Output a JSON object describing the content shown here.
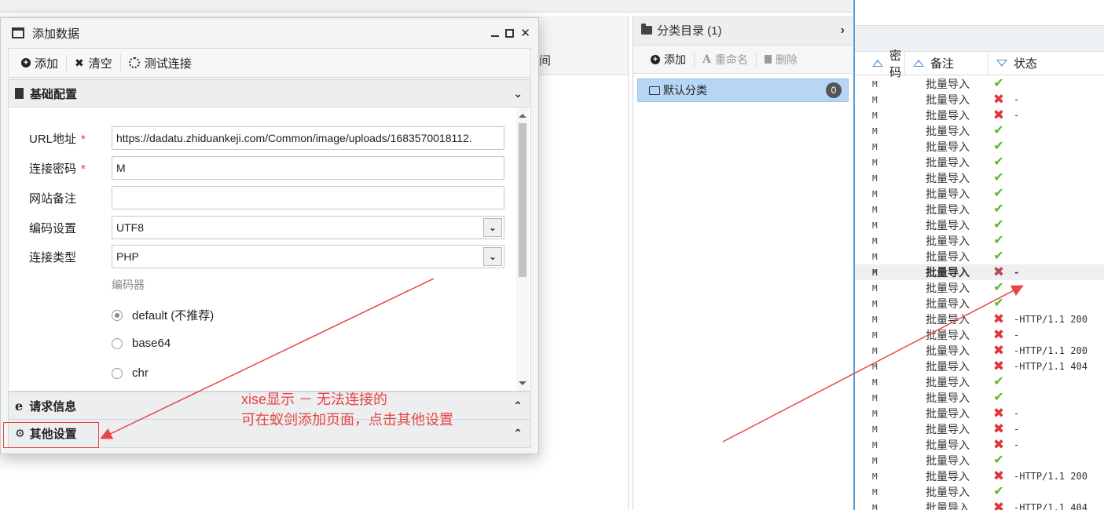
{
  "background": {
    "column_label": "间"
  },
  "category_panel": {
    "title": "分类目录 (1)",
    "toolbar": {
      "add": "添加",
      "rename": "重命名",
      "delete": "删除"
    },
    "items": [
      {
        "label": "默认分类",
        "count": "0"
      }
    ]
  },
  "list_panel": {
    "headers": {
      "password": "密码",
      "note": "备注",
      "status": "状态"
    },
    "rows": [
      {
        "pw": "M",
        "note": "批量导入",
        "ok": true,
        "text": ""
      },
      {
        "pw": "M",
        "note": "批量导入",
        "ok": false,
        "text": "-"
      },
      {
        "pw": "M",
        "note": "批量导入",
        "ok": false,
        "text": "-"
      },
      {
        "pw": "M",
        "note": "批量导入",
        "ok": true,
        "text": ""
      },
      {
        "pw": "M",
        "note": "批量导入",
        "ok": true,
        "text": ""
      },
      {
        "pw": "M",
        "note": "批量导入",
        "ok": true,
        "text": ""
      },
      {
        "pw": "M",
        "note": "批量导入",
        "ok": true,
        "text": ""
      },
      {
        "pw": "M",
        "note": "批量导入",
        "ok": true,
        "text": ""
      },
      {
        "pw": "M",
        "note": "批量导入",
        "ok": true,
        "text": ""
      },
      {
        "pw": "M",
        "note": "批量导入",
        "ok": true,
        "text": ""
      },
      {
        "pw": "M",
        "note": "批量导入",
        "ok": true,
        "text": ""
      },
      {
        "pw": "M",
        "note": "批量导入",
        "ok": true,
        "text": ""
      },
      {
        "pw": "M",
        "note": "批量导入",
        "ok": false,
        "text": "-",
        "highlight": true
      },
      {
        "pw": "M",
        "note": "批量导入",
        "ok": true,
        "text": ""
      },
      {
        "pw": "M",
        "note": "批量导入",
        "ok": true,
        "text": ""
      },
      {
        "pw": "M",
        "note": "批量导入",
        "ok": false,
        "text": "-HTTP/1.1 200"
      },
      {
        "pw": "M",
        "note": "批量导入",
        "ok": false,
        "text": "-"
      },
      {
        "pw": "M",
        "note": "批量导入",
        "ok": false,
        "text": "-HTTP/1.1 200"
      },
      {
        "pw": "M",
        "note": "批量导入",
        "ok": false,
        "text": "-HTTP/1.1 404"
      },
      {
        "pw": "M",
        "note": "批量导入",
        "ok": true,
        "text": ""
      },
      {
        "pw": "M",
        "note": "批量导入",
        "ok": true,
        "text": ""
      },
      {
        "pw": "M",
        "note": "批量导入",
        "ok": false,
        "text": "-"
      },
      {
        "pw": "M",
        "note": "批量导入",
        "ok": false,
        "text": "-"
      },
      {
        "pw": "M",
        "note": "批量导入",
        "ok": false,
        "text": "-"
      },
      {
        "pw": "M",
        "note": "批量导入",
        "ok": true,
        "text": ""
      },
      {
        "pw": "M",
        "note": "批量导入",
        "ok": false,
        "text": "-HTTP/1.1 200"
      },
      {
        "pw": "M",
        "note": "批量导入",
        "ok": true,
        "text": ""
      },
      {
        "pw": "M",
        "note": "批量导入",
        "ok": false,
        "text": "-HTTP/1.1 404"
      }
    ]
  },
  "dialog": {
    "title": "添加数据",
    "toolbar": {
      "add": "添加",
      "clear": "清空",
      "test": "测试连接"
    },
    "sections": {
      "basic": "基础配置",
      "request": "请求信息",
      "other": "其他设置"
    },
    "form": {
      "url_label": "URL地址",
      "url_value": "https://dadatu.zhiduankeji.com/Common/image/uploads/1683570018112.",
      "password_label": "连接密码",
      "password_value": "M",
      "note_label": "网站备注",
      "note_value": "",
      "encoding_label": "编码设置",
      "encoding_value": "UTF8",
      "type_label": "连接类型",
      "type_value": "PHP",
      "encoder_label": "编码器",
      "encoders": [
        {
          "label": "default (不推荐)",
          "selected": true
        },
        {
          "label": "base64",
          "selected": false
        },
        {
          "label": "chr",
          "selected": false
        }
      ]
    }
  },
  "annotation": {
    "line1": "xise显示 － 无法连接的",
    "line2": "可在蚁剑添加页面，点击其他设置",
    "color": "#e84444"
  }
}
